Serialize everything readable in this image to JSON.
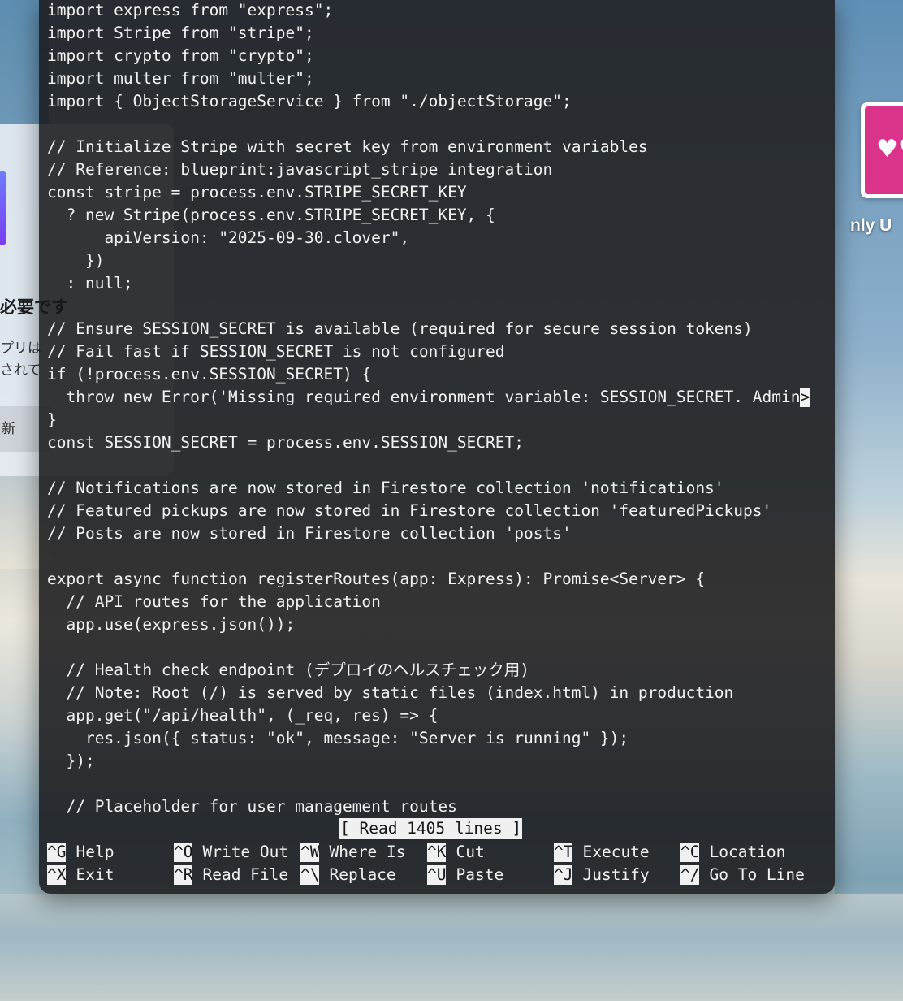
{
  "terminal": {
    "lines": [
      "import express from \"express\";",
      "import Stripe from \"stripe\";",
      "import crypto from \"crypto\";",
      "import multer from \"multer\";",
      "import { ObjectStorageService } from \"./objectStorage\";",
      "",
      "// Initialize Stripe with secret key from environment variables",
      "// Reference: blueprint:javascript_stripe integration",
      "const stripe = process.env.STRIPE_SECRET_KEY",
      "  ? new Stripe(process.env.STRIPE_SECRET_KEY, {",
      "      apiVersion: \"2025-09-30.clover\",",
      "    })",
      "  : null;",
      "",
      "// Ensure SESSION_SECRET is available (required for secure session tokens)",
      "// Fail fast if SESSION_SECRET is not configured",
      "if (!process.env.SESSION_SECRET) {",
      "  throw new Error('Missing required environment variable: SESSION_SECRET. Admin",
      "}",
      "const SESSION_SECRET = process.env.SESSION_SECRET;",
      "",
      "// Notifications are now stored in Firestore collection 'notifications'",
      "// Featured pickups are now stored in Firestore collection 'featuredPickups'",
      "// Posts are now stored in Firestore collection 'posts'",
      "",
      "export async function registerRoutes(app: Express): Promise<Server> {",
      "  // API routes for the application",
      "  app.use(express.json());",
      "",
      "  // Health check endpoint (デプロイのヘルスチェック用)",
      "  // Note: Root (/) is served by static files (index.html) in production",
      "  app.get(\"/api/health\", (_req, res) => {",
      "    res.json({ status: \"ok\", message: \"Server is running\" });",
      "  });",
      "",
      "  // Placeholder for user management routes"
    ],
    "overflow_marker": ">",
    "status": "[ Read 1405 lines ]",
    "shortcuts": [
      {
        "key": "^G",
        "label": "Help"
      },
      {
        "key": "^O",
        "label": "Write Out"
      },
      {
        "key": "^W",
        "label": "Where Is"
      },
      {
        "key": "^K",
        "label": "Cut"
      },
      {
        "key": "^T",
        "label": "Execute"
      },
      {
        "key": "^C",
        "label": "Location"
      },
      {
        "key": "^X",
        "label": "Exit"
      },
      {
        "key": "^R",
        "label": "Read File"
      },
      {
        "key": "^\\",
        "label": "Replace"
      },
      {
        "key": "^U",
        "label": "Paste"
      },
      {
        "key": "^J",
        "label": "Justify"
      },
      {
        "key": "^/",
        "label": "Go To Line"
      }
    ]
  },
  "background_dialog": {
    "title": "必要です",
    "text_line1": "プリは",
    "text_line2": "されて",
    "button_label": "新"
  },
  "desktop_app": {
    "label": "nly U",
    "icon": "heart-cluster-icon"
  },
  "colors": {
    "terminal_bg": "#161618",
    "terminal_text": "#f2f2f2",
    "app_icon": "#d9348a"
  }
}
